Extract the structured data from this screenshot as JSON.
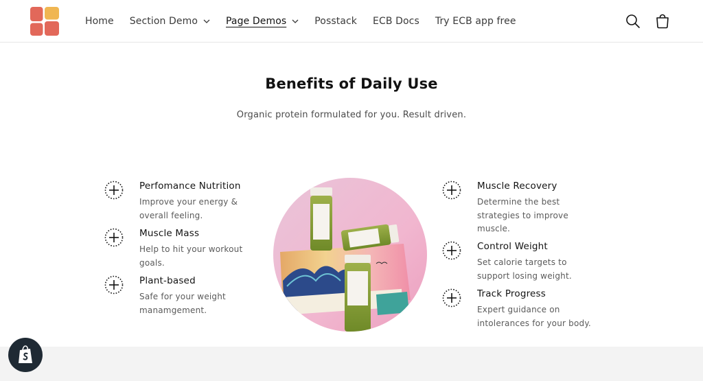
{
  "header": {
    "logo": "logo-grid-icon",
    "nav": [
      {
        "label": "Home"
      },
      {
        "label": "Section Demo",
        "has_dropdown": true
      },
      {
        "label": "Page Demos",
        "has_dropdown": true,
        "active": true
      },
      {
        "label": "Posstack"
      },
      {
        "label": "ECB Docs"
      },
      {
        "label": "Try ECB app free"
      }
    ],
    "icons": [
      "search-icon",
      "cart-icon"
    ]
  },
  "hero": {
    "title": "Benefits of Daily Use",
    "subtitle": "Organic protein formulated for you. Result driven."
  },
  "benefits_left": [
    {
      "title": "Perfomance Nutrition",
      "text": "Improve your energy & overall feeling."
    },
    {
      "title": "Muscle Mass",
      "text": "Help to hit your workout goals."
    },
    {
      "title": "Plant-based",
      "text": "Safe for your weight manamgement."
    }
  ],
  "benefits_right": [
    {
      "title": "Muscle Recovery",
      "text": "Determine the best strategies to improve muscle."
    },
    {
      "title": "Control Weight",
      "text": "Set calorie targets to support losing weight."
    },
    {
      "title": "Track Progress",
      "text": "Expert guidance on intolerances for your body."
    }
  ],
  "colors": {
    "logo_red": "#e2685a",
    "logo_yellow": "#f0b652",
    "text": "#121212",
    "muted": "#5a5a5a",
    "footer_band": "#f3f3f3",
    "badge": "#1f2a34"
  },
  "badge": "shopify-bag-icon"
}
